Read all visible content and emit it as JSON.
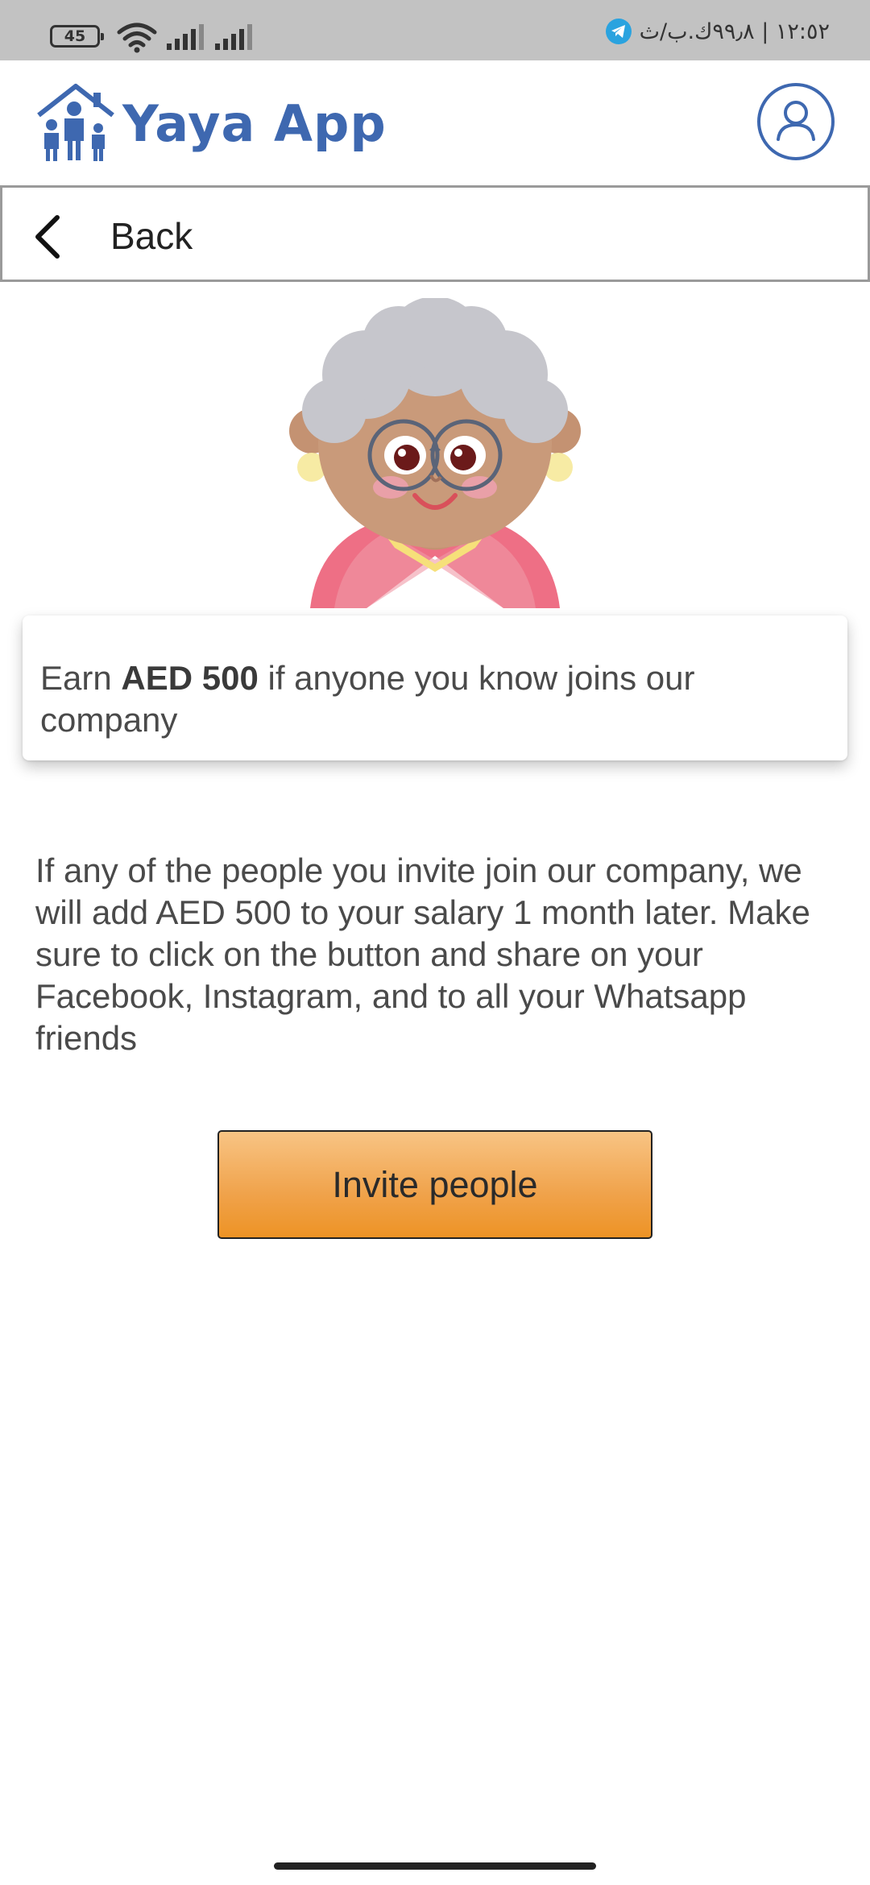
{
  "status_bar": {
    "battery": "45",
    "right_text": "١٢:٥٢ | ٩٩٫٨ك.ب/ث"
  },
  "header": {
    "app_title": "Yaya App",
    "brand_color": "#3e68b0"
  },
  "nav": {
    "back_label": "Back"
  },
  "card": {
    "prefix": "Earn ",
    "amount": "AED 500",
    "suffix": " if anyone you know joins our company"
  },
  "description": "If any of the people you invite join our company, we will add AED 500 to your salary 1 month later. Make sure to click on the button and share on your Facebook, Instagram, and to all your Whatsapp friends",
  "actions": {
    "invite_label": "Invite people",
    "button_color": "#f0a24a"
  },
  "icons": [
    "battery-icon",
    "wifi-icon",
    "signal-icon",
    "telegram-icon",
    "house-family-logo-icon",
    "user-profile-icon",
    "back-chevron-icon",
    "grandmother-illustration"
  ]
}
